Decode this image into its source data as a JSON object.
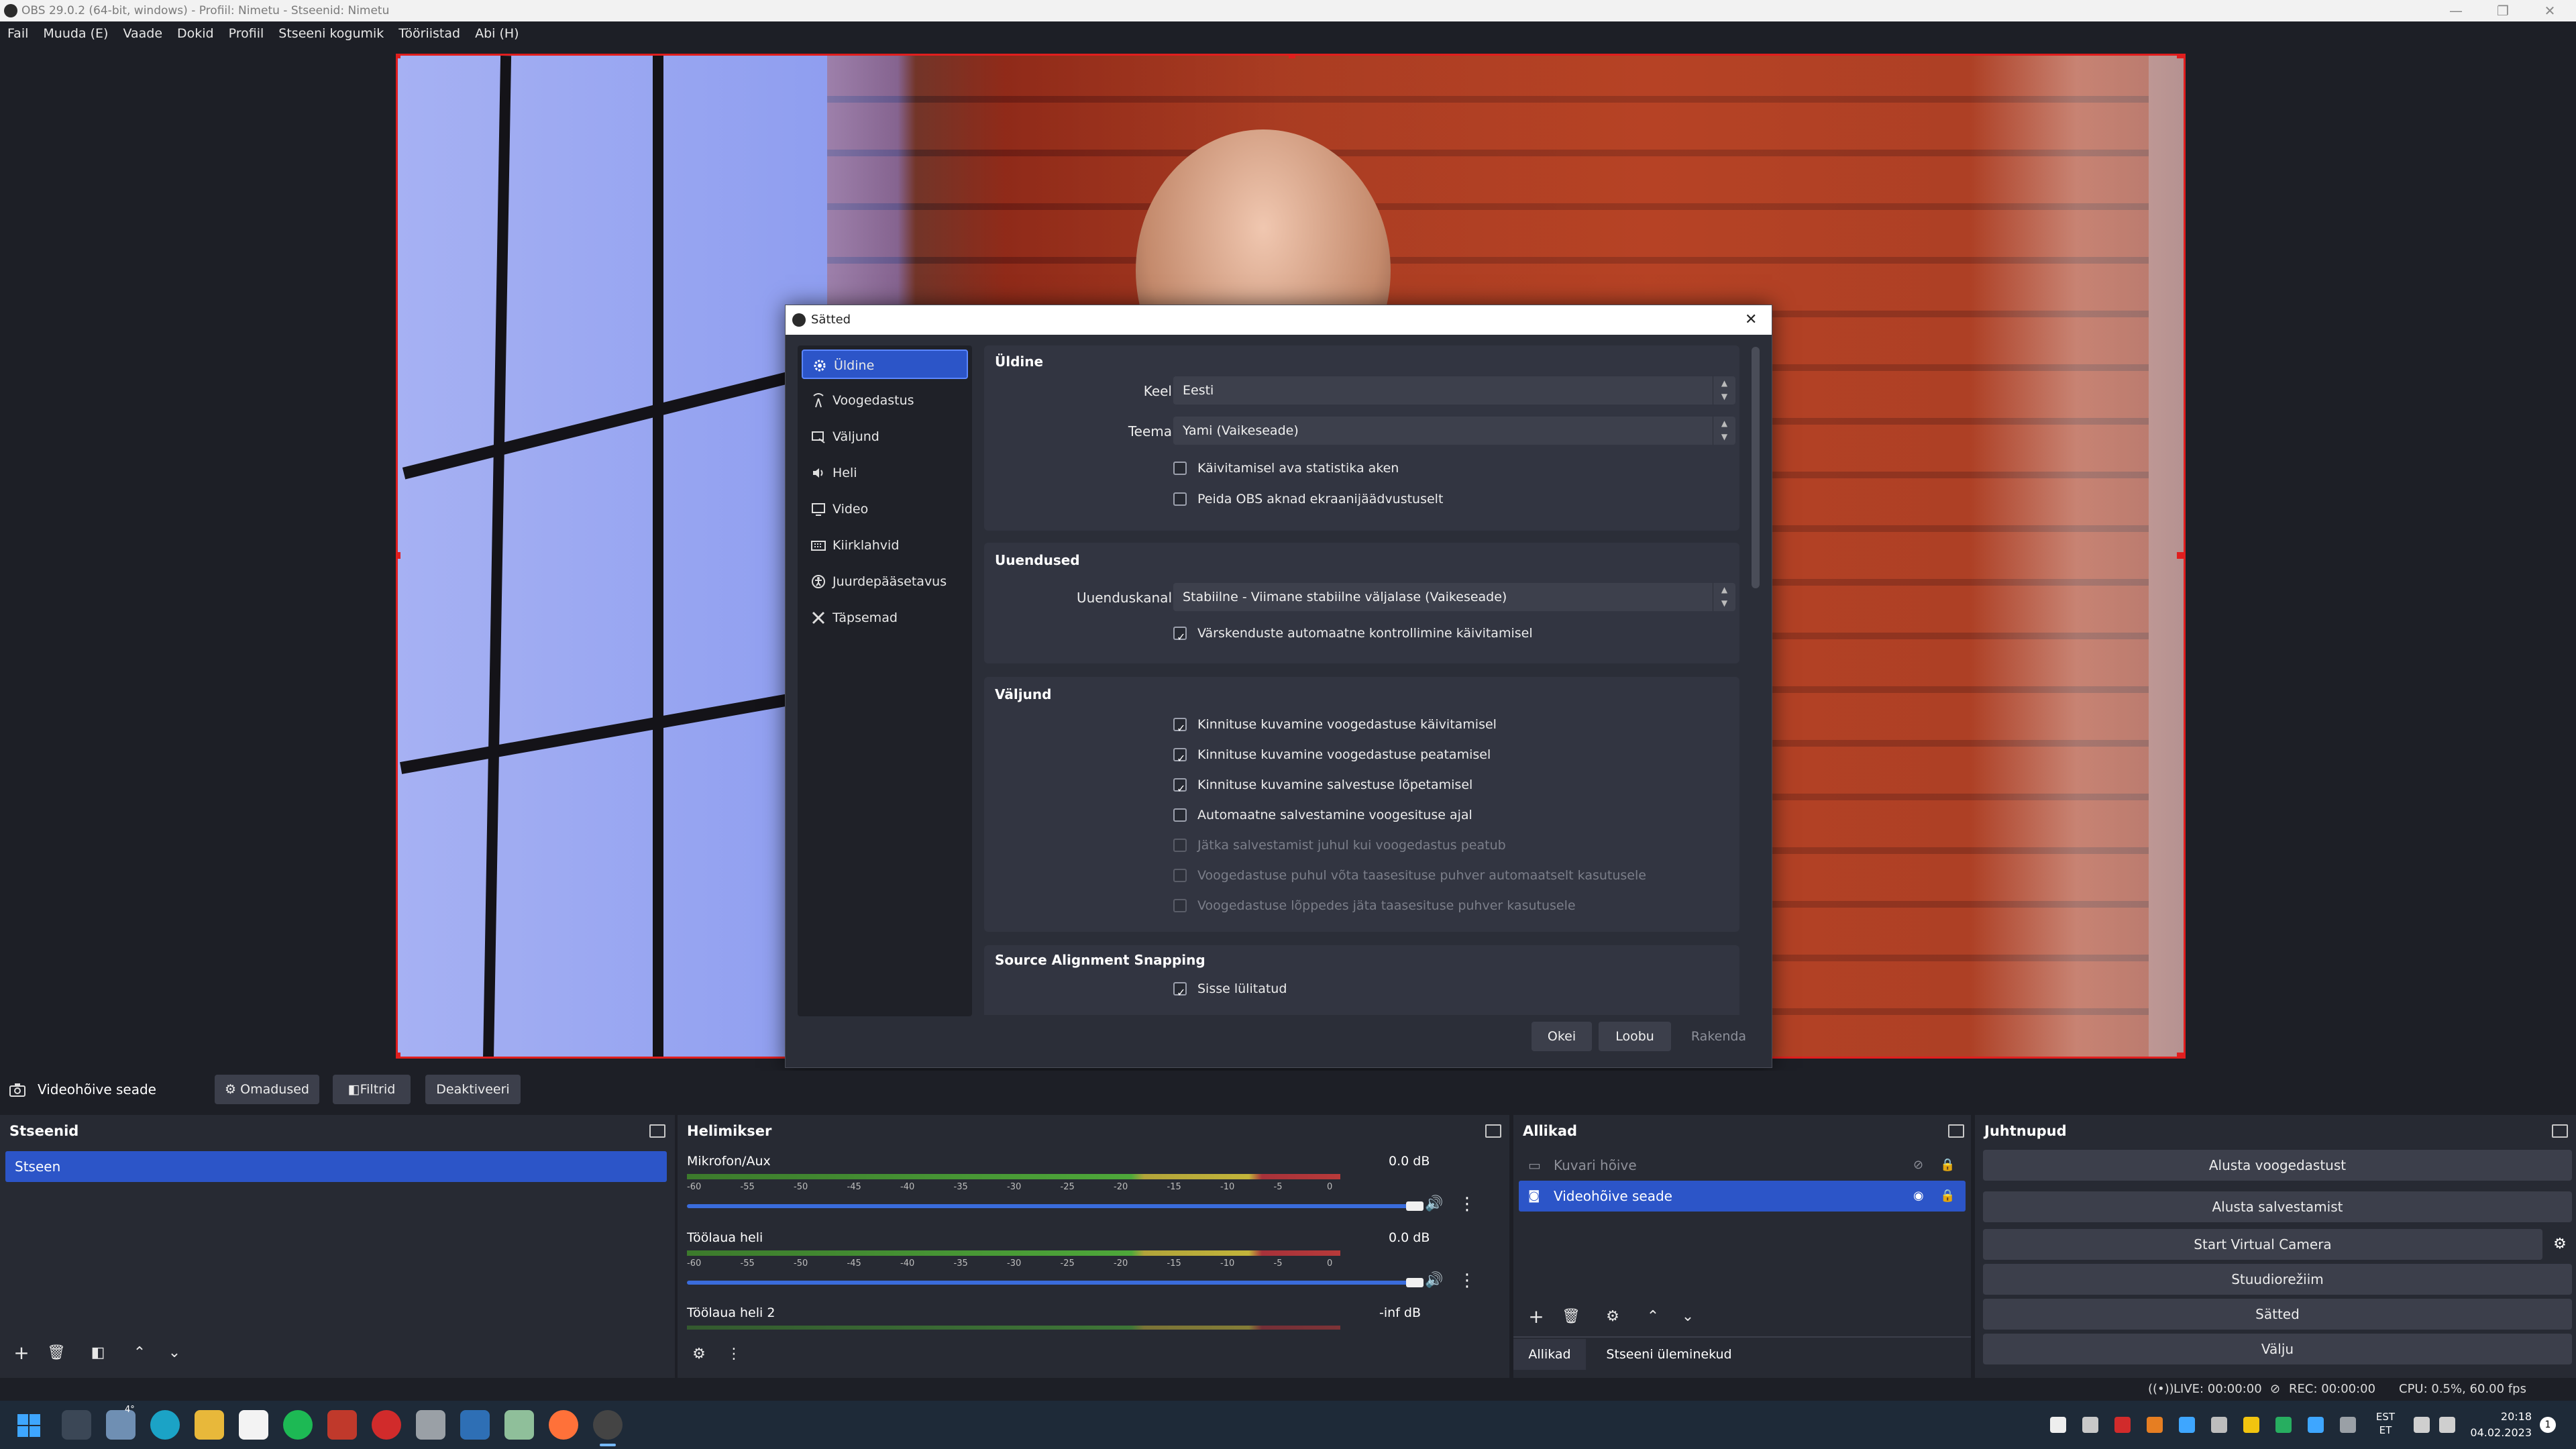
{
  "window": {
    "title": "OBS 29.0.2 (64-bit, windows) - Profiil: Nimetu - Stseenid: Nimetu",
    "minimize": "—",
    "restore": "❐",
    "close": "✕"
  },
  "menu": [
    "Fail",
    "Muuda (E)",
    "Vaade",
    "Dokid",
    "Profiil",
    "Stseeni kogumik",
    "Tööriistad",
    "Abi (H)"
  ],
  "dialog": {
    "title": "Sätted",
    "nav": [
      {
        "label": "Üldine",
        "icon": "gear-icon",
        "selected": true
      },
      {
        "label": "Voogedastus",
        "icon": "antenna-icon",
        "selected": false
      },
      {
        "label": "Väljund",
        "icon": "output-icon",
        "selected": false
      },
      {
        "label": "Heli",
        "icon": "speaker-icon",
        "selected": false
      },
      {
        "label": "Video",
        "icon": "monitor-icon",
        "selected": false
      },
      {
        "label": "Kiirklahvid",
        "icon": "keyboard-icon",
        "selected": false
      },
      {
        "label": "Juurdepääsetavus",
        "icon": "accessibility-icon",
        "selected": false
      },
      {
        "label": "Täpsemad",
        "icon": "tools-icon",
        "selected": false
      }
    ],
    "general": {
      "title": "Üldine",
      "language_label": "Keel",
      "language_value": "Eesti",
      "theme_label": "Teema",
      "theme_value": "Yami (Vaikeseade)",
      "checkboxes": [
        {
          "label": "Käivitamisel ava statistika aken",
          "checked": false,
          "disabled": false
        },
        {
          "label": "Peida OBS aknad ekraanijäädvustuselt",
          "checked": false,
          "disabled": false
        }
      ]
    },
    "updates": {
      "title": "Uuendused",
      "channel_label": "Uuenduskanal",
      "channel_value": "Stabiilne - Viimane stabiilne väljalase (Vaikeseade)",
      "checkboxes": [
        {
          "label": "Värskenduste automaatne kontrollimine käivitamisel",
          "checked": true,
          "disabled": false
        }
      ]
    },
    "output": {
      "title": "Väljund",
      "checkboxes": [
        {
          "label": "Kinnituse kuvamine voogedastuse käivitamisel",
          "checked": true,
          "disabled": false
        },
        {
          "label": "Kinnituse kuvamine voogedastuse peatamisel",
          "checked": true,
          "disabled": false
        },
        {
          "label": "Kinnituse kuvamine salvestuse lõpetamisel",
          "checked": true,
          "disabled": false
        },
        {
          "label": "Automaatne salvestamine voogesituse ajal",
          "checked": false,
          "disabled": false
        },
        {
          "label": "Jätka salvestamist juhul kui voogedastus peatub",
          "checked": false,
          "disabled": true
        },
        {
          "label": "Voogedastuse puhul võta taasesituse puhver automaatselt kasutusele",
          "checked": false,
          "disabled": true
        },
        {
          "label": "Voogedastuse lõppedes jäta taasesituse puhver kasutusele",
          "checked": false,
          "disabled": true
        }
      ]
    },
    "snapping": {
      "title": "Source Alignment Snapping",
      "checkboxes": [
        {
          "label": "Sisse lülitatud",
          "checked": true,
          "disabled": false
        }
      ]
    },
    "buttons": {
      "ok": "Okei",
      "cancel": "Loobu",
      "apply": "Rakenda"
    }
  },
  "source_toolbar": {
    "source_name": "Videohõive seade",
    "properties": "Omadused",
    "filters": "Filtrid",
    "deactivate": "Deaktiveeri"
  },
  "scenes": {
    "title": "Stseenid",
    "items": [
      "Stseen"
    ]
  },
  "mixer": {
    "title": "Helimikser",
    "channels": [
      {
        "name": "Mikrofon/Aux",
        "db": "0.0 dB"
      },
      {
        "name": "Töölaua heli",
        "db": "0.0 dB"
      },
      {
        "name": "Töölaua heli 2",
        "db": "-inf dB"
      }
    ],
    "scale": [
      "-60",
      "-55",
      "-50",
      "-45",
      "-40",
      "-35",
      "-30",
      "-25",
      "-20",
      "-15",
      "-10",
      "-5",
      "0"
    ]
  },
  "sources": {
    "title": "Allikad",
    "items": [
      {
        "name": "Kuvari hõive",
        "visible": false,
        "selected": false
      },
      {
        "name": "Videohõive seade",
        "visible": true,
        "selected": true
      }
    ],
    "tabs": [
      "Allikad",
      "Stseeni üleminekud"
    ]
  },
  "controls": {
    "title": "Juhtnupud",
    "start_stream": "Alusta voogedastust",
    "start_record": "Alusta salvestamist",
    "virtual_cam": "Start Virtual Camera",
    "studio_mode": "Stuudiorežiim",
    "settings": "Sätted",
    "exit": "Välju"
  },
  "status": {
    "live": "LIVE: 00:00:00",
    "rec": "REC: 00:00:00",
    "cpu": "CPU: 0.5%, 60.00 fps"
  },
  "taskbar": {
    "lang_top": "EST",
    "lang_bottom": "ET",
    "time": "20:18",
    "date": "04.02.2023",
    "weather": "4°",
    "notification_count": "1"
  }
}
